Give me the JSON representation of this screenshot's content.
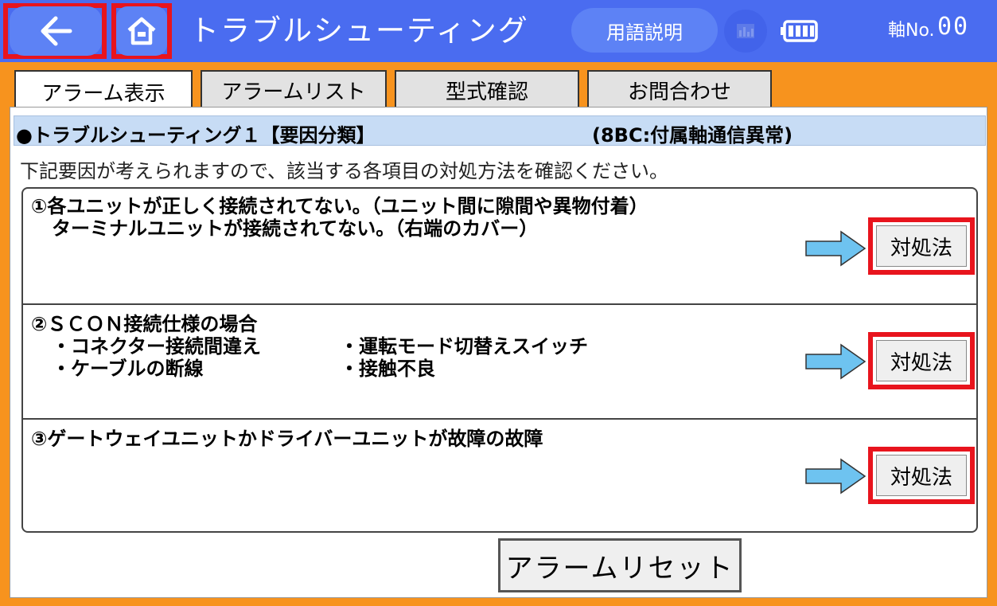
{
  "header": {
    "title": "トラブルシューティング",
    "glossary_label": "用語説明",
    "axis_label": "軸No.",
    "axis_value": "00"
  },
  "tabs": [
    {
      "label": "アラーム表示",
      "active": true
    },
    {
      "label": "アラームリスト",
      "active": false
    },
    {
      "label": "型式確認",
      "active": false
    },
    {
      "label": "お問合わせ",
      "active": false
    }
  ],
  "section": {
    "title": "●トラブルシューティング１【要因分類】",
    "code": "(8BC:付属軸通信異常)"
  },
  "instruction": "下記要因が考えられますので、該当する各項目の対処方法を確認ください。",
  "items": [
    {
      "line1": "①各ユニットが正しく接続されてない。（ユニット間に隙間や異物付着）",
      "line2": "ターミナルユニットが接続されてない。（右端のカバー）",
      "action_label": "対処法"
    },
    {
      "line1": "②ＳＣＯＮ接続仕様の場合",
      "bullets": [
        "・コネクター接続間違え",
        "・運転モード切替えスイッチ",
        "・ケーブルの断線",
        "・接触不良"
      ],
      "action_label": "対処法"
    },
    {
      "line1": "③ゲートウェイユニットかドライバーユニットが故障の故障",
      "action_label": "対処法"
    }
  ],
  "reset_label": "アラームリセット",
  "icons": {
    "back": "back-arrow-icon",
    "home": "home-icon",
    "chart": "chart-icon",
    "battery": "battery-icon",
    "action_arrow": "right-arrow-icon"
  },
  "colors": {
    "header": "#4a6cf0",
    "frame": "#f7931e",
    "highlight": "#e8141d",
    "section_bar": "#c7dcf5",
    "arrow": "#6ec3f0"
  }
}
